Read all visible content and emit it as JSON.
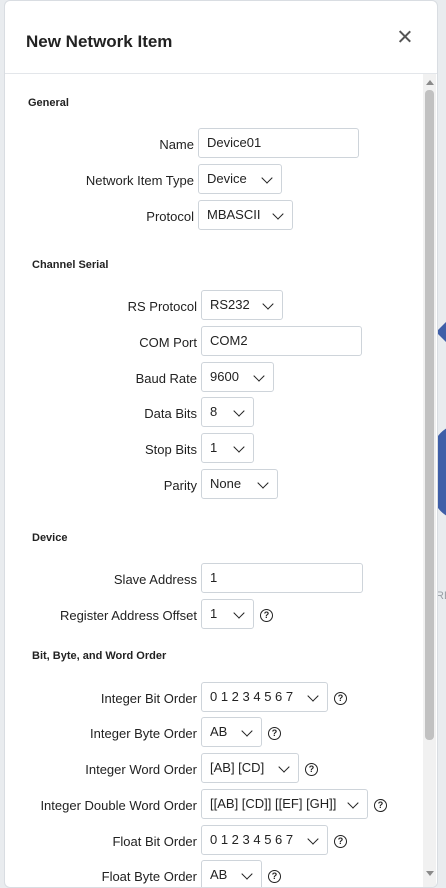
{
  "modal": {
    "title": "New Network Item"
  },
  "sections": {
    "general": "General",
    "channel_serial": "Channel Serial",
    "device": "Device",
    "order": "Bit, Byte, and Word Order"
  },
  "general": {
    "name_label": "Name",
    "name_value": "Device01",
    "type_label": "Network Item Type",
    "type_value": "Device",
    "protocol_label": "Protocol",
    "protocol_value": "MBASCII"
  },
  "serial": {
    "rs_label": "RS Protocol",
    "rs_value": "RS232",
    "com_label": "COM Port",
    "com_value": "COM2",
    "baud_label": "Baud Rate",
    "baud_value": "9600",
    "data_label": "Data Bits",
    "data_value": "8",
    "stop_label": "Stop Bits",
    "stop_value": "1",
    "parity_label": "Parity",
    "parity_value": "None"
  },
  "device": {
    "slave_label": "Slave Address",
    "slave_value": "1",
    "offset_label": "Register Address Offset",
    "offset_value": "1"
  },
  "order": {
    "int_bit_label": "Integer Bit Order",
    "int_bit_value": "0 1 2 3 4 5 6 7",
    "int_byte_label": "Integer Byte Order",
    "int_byte_value": "AB",
    "int_word_label": "Integer Word Order",
    "int_word_value": "[AB] [CD]",
    "int_dword_label": "Integer Double Word Order",
    "int_dword_value": "[[AB] [CD]] [[EF] [GH]]",
    "float_bit_label": "Float Bit Order",
    "float_bit_value": "0 1 2 3 4 5 6 7",
    "float_byte_label": "Float Byte Order",
    "float_byte_value": "AB"
  },
  "background": {
    "partial_text": "RE"
  },
  "icons": {
    "close": "close-icon",
    "help": "help-icon",
    "chevron": "chevron-down-icon"
  }
}
